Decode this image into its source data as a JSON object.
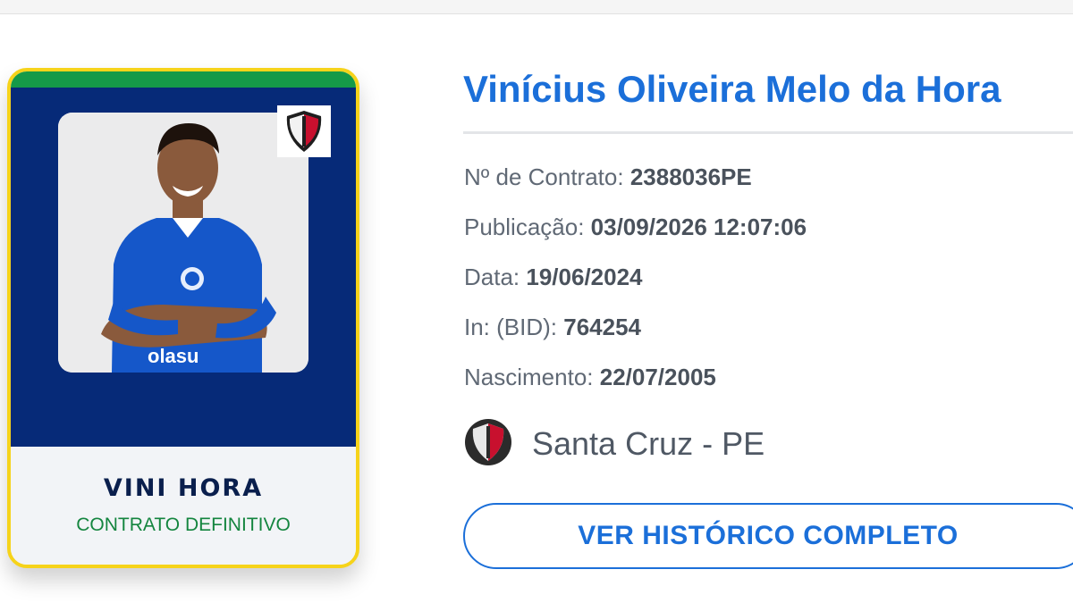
{
  "card": {
    "nickname": "VINI HORA",
    "status": "CONTRATO DEFINITIVO",
    "club_crest_icon": "santa-cruz-crest-icon",
    "photo_icon": "player-photo",
    "colors": {
      "border": "#f6d31a",
      "stripe": "#159a48",
      "body": "#062a78",
      "status": "#14853f"
    }
  },
  "player": {
    "full_name": "Vinícius Oliveira Melo da Hora"
  },
  "details": {
    "contract": {
      "label": "Nº de Contrato:",
      "value": "2388036PE"
    },
    "publication": {
      "label": "Publicação:",
      "value": "03/09/2026 12:07:06"
    },
    "date": {
      "label": "Data:",
      "value": "19/06/2024"
    },
    "bid": {
      "label": "In: (BID):",
      "value": "764254"
    },
    "birth": {
      "label": "Nascimento:",
      "value": "22/07/2005"
    }
  },
  "club": {
    "name": "Santa Cruz - PE",
    "icon": "santa-cruz-crest-icon"
  },
  "history_button": {
    "label": "VER HISTÓRICO COMPLETO"
  },
  "accent_color": "#1b6fd9"
}
